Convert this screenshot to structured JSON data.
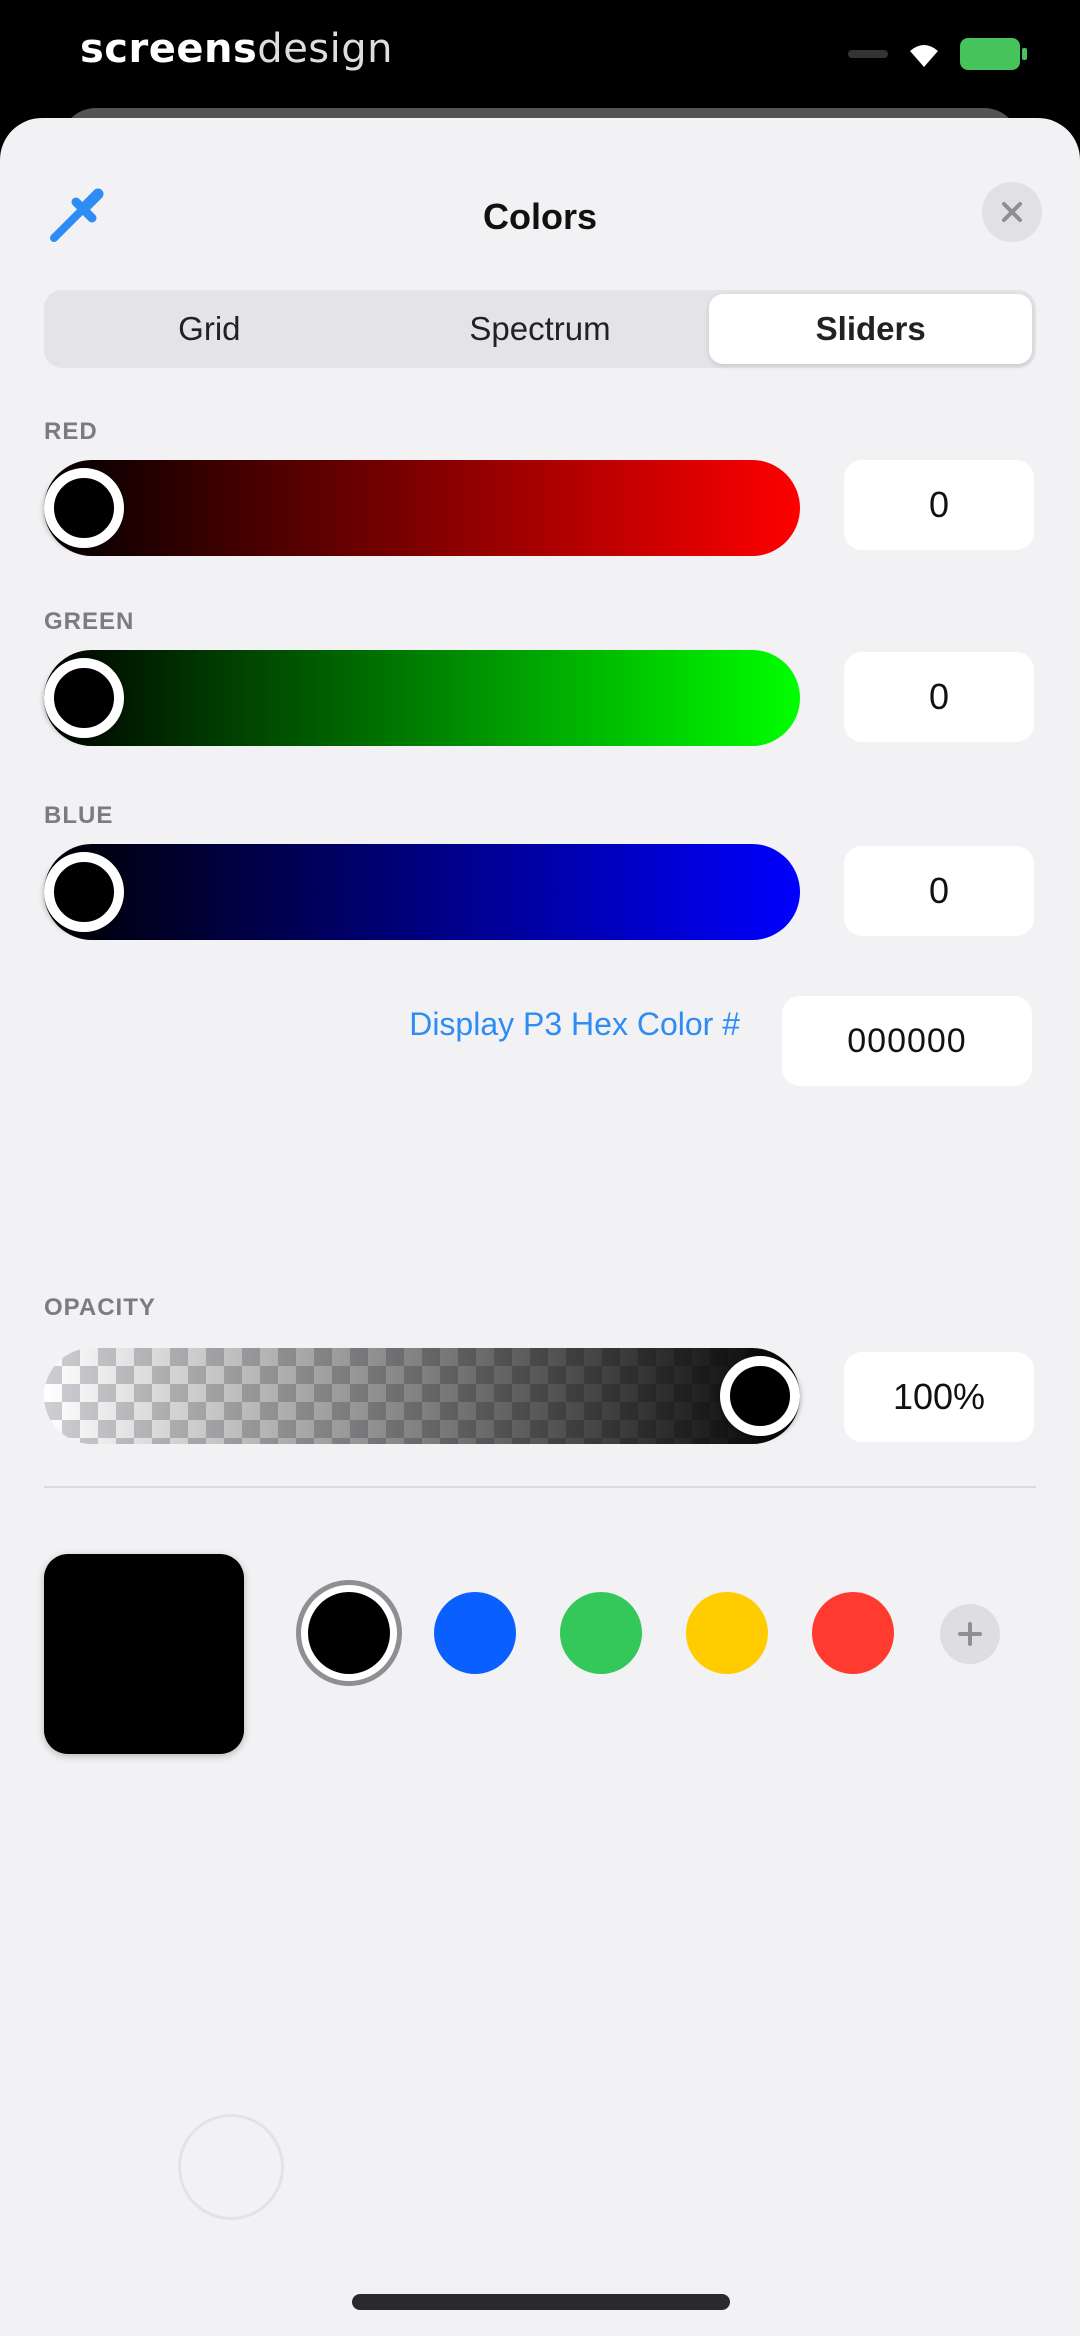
{
  "status_bar": {
    "title_bold": "screens",
    "title_light": "design"
  },
  "sheet": {
    "title": "Colors"
  },
  "tabs": [
    {
      "label": "Grid",
      "active": false
    },
    {
      "label": "Spectrum",
      "active": false
    },
    {
      "label": "Sliders",
      "active": true
    }
  ],
  "sliders": {
    "red": {
      "label": "RED",
      "value": "0",
      "level": 0
    },
    "green": {
      "label": "GREEN",
      "value": "0",
      "level": 0
    },
    "blue": {
      "label": "BLUE",
      "value": "0",
      "level": 0
    }
  },
  "hex": {
    "label": "Display P3 Hex Color #",
    "value": "000000"
  },
  "opacity": {
    "label": "OPACITY",
    "value": "100%",
    "level": 1.0
  },
  "current_color": "#000000",
  "presets": [
    {
      "name": "black",
      "color": "#000000",
      "selected": true
    },
    {
      "name": "blue",
      "color": "#0a60ff",
      "selected": false
    },
    {
      "name": "green",
      "color": "#34c759",
      "selected": false
    },
    {
      "name": "yellow",
      "color": "#ffcc00",
      "selected": false
    },
    {
      "name": "red",
      "color": "#ff3b30",
      "selected": false
    }
  ],
  "icons": {
    "eyedropper": "eyedropper-icon",
    "close": "close-icon",
    "add": "plus-icon",
    "wifi": "wifi-icon",
    "battery": "battery-icon"
  },
  "accent_color": "#2f8cf5"
}
